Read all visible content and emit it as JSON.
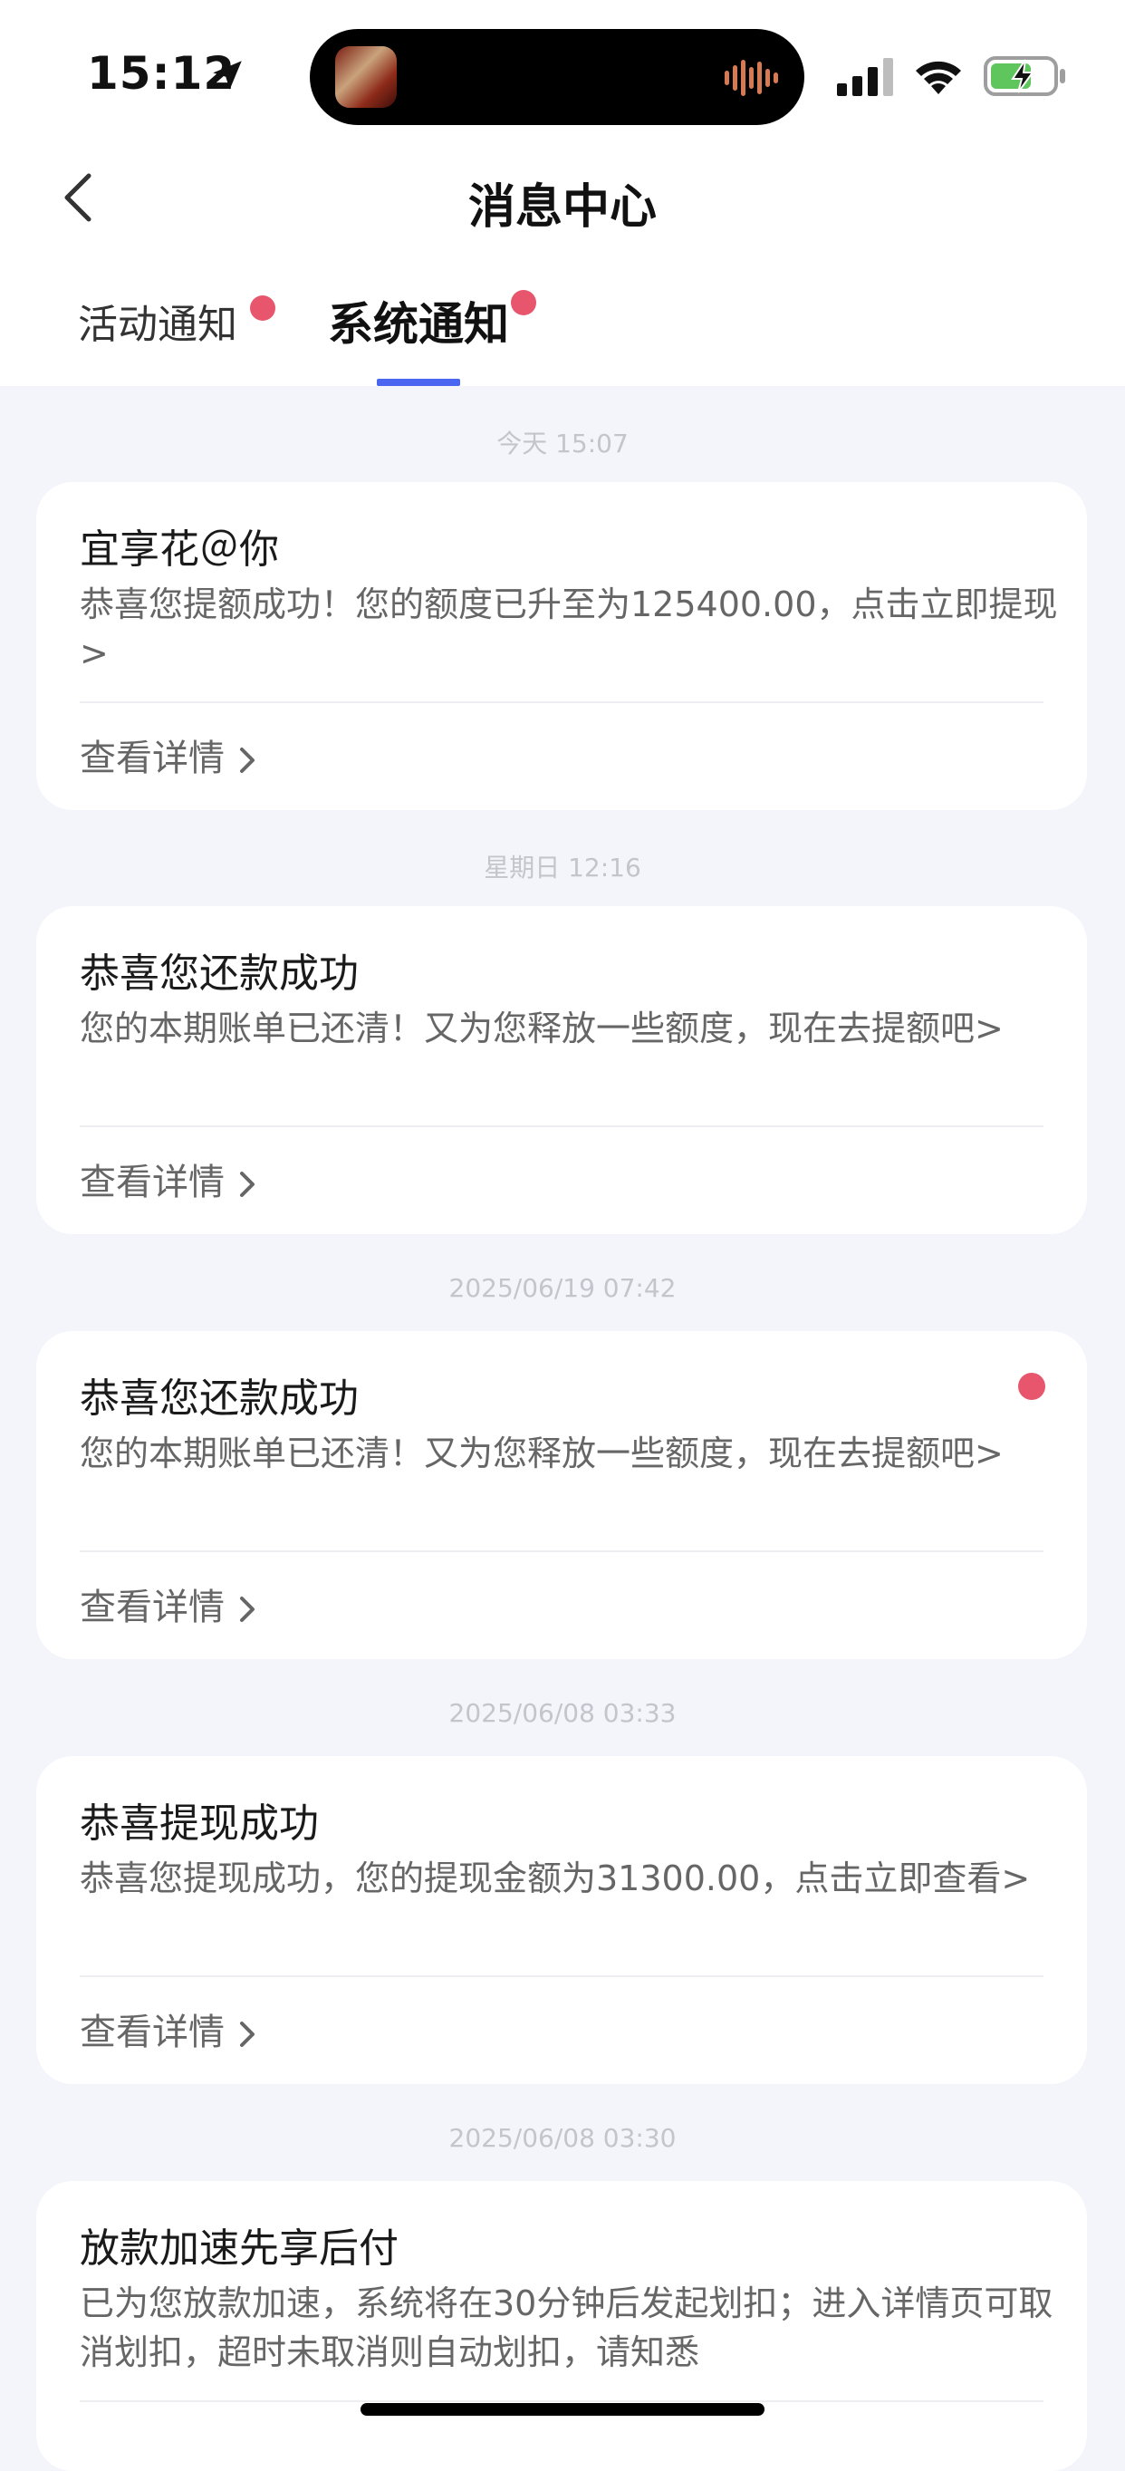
{
  "status_bar": {
    "time": "15:12",
    "icons": [
      "location-arrow-icon",
      "audio-wave-icon",
      "signal-icon",
      "wifi-icon",
      "battery-charging-icon"
    ]
  },
  "nav": {
    "title": "消息中心",
    "back_icon": "chevron-left-icon"
  },
  "tabs": [
    {
      "label": "活动通知",
      "active": false,
      "has_dot": true
    },
    {
      "label": "系统通知",
      "active": true,
      "has_dot": true
    }
  ],
  "messages": [
    {
      "timestamp": "今天 15:07",
      "title": "宜享花＠你",
      "body": "恭喜您提额成功！您的额度已升至为125400.00，点击立即提现>",
      "link": "查看详情",
      "unread": false
    },
    {
      "timestamp": "星期日 12:16",
      "title": "恭喜您还款成功",
      "body": "您的本期账单已还清！又为您释放一些额度，现在去提额吧>",
      "link": "查看详情",
      "unread": false
    },
    {
      "timestamp": "2025/06/19 07:42",
      "title": "恭喜您还款成功",
      "body": "您的本期账单已还清！又为您释放一些额度，现在去提额吧>",
      "link": "查看详情",
      "unread": true
    },
    {
      "timestamp": "2025/06/08 03:33",
      "title": "恭喜提现成功",
      "body": "恭喜您提现成功，您的提现金额为31300.00，点击立即查看>",
      "link": "查看详情",
      "unread": false
    },
    {
      "timestamp": "2025/06/08 03:30",
      "title": "放款加速先享后付",
      "body": "已为您放款加速，系统将在30分钟后发起划扣；进入详情页可取消划扣，超时未取消则自动划扣，请知悉",
      "link": "",
      "unread": false
    }
  ],
  "colors": {
    "accent_underline": "#4a65f0",
    "unread_dot": "#e8566d",
    "background": "#f4f5fb"
  }
}
